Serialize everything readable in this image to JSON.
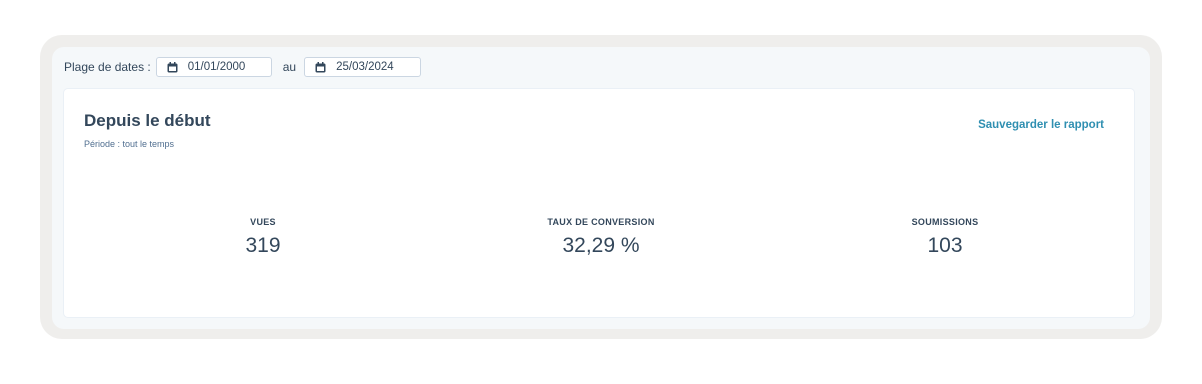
{
  "date_range": {
    "label": "Plage de dates :",
    "start": "01/01/2000",
    "separator": "au",
    "end": "25/03/2024"
  },
  "report": {
    "title": "Depuis le début",
    "subtitle": "Période : tout le temps",
    "save_label": "Sauvegarder le rapport"
  },
  "stats": [
    {
      "label": "VUES",
      "value": "319"
    },
    {
      "label": "TAUX DE CONVERSION",
      "value": "32,29 %"
    },
    {
      "label": "SOUMISSIONS",
      "value": "103"
    }
  ],
  "icons": {
    "date_field_icon": "calendar-icon"
  },
  "colors": {
    "text": "#33475b",
    "link": "#2f8fb1",
    "frame": "#efeeec",
    "panel": "#f5f8fa"
  }
}
